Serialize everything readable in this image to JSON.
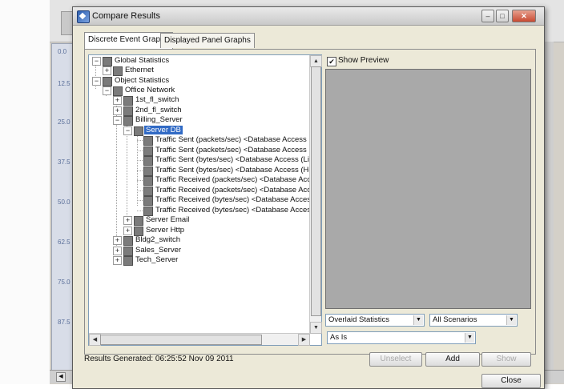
{
  "background": {
    "axis_ticks": [
      "0.0",
      "12.5",
      "25.0",
      "37.5",
      "50.0",
      "62.5",
      "75.0",
      "87.5"
    ]
  },
  "dialog": {
    "title": "Compare Results",
    "titlebar_buttons": {
      "minimize": "–",
      "maximize": "□",
      "close": "✕"
    },
    "tabs": [
      {
        "label": "Discrete Event Graphs",
        "active": true
      },
      {
        "label": "Displayed Panel Graphs",
        "active": false
      }
    ],
    "tree": {
      "items": [
        {
          "label": "Global Statistics",
          "expanded": true
        },
        {
          "label": "Ethernet",
          "expanded": false
        },
        {
          "label": "Object Statistics",
          "expanded": true
        },
        {
          "label": "Office Network",
          "expanded": true
        },
        {
          "label": "1st_fl_switch",
          "expanded": false
        },
        {
          "label": "2nd_fl_switch",
          "expanded": false
        },
        {
          "label": "Billing_Server",
          "expanded": true
        },
        {
          "label": "Server DB",
          "expanded": true,
          "selected": true
        },
        {
          "label": "Traffic Sent (packets/sec) <Database Access (L"
        },
        {
          "label": "Traffic Sent (packets/sec) <Database Access (H"
        },
        {
          "label": "Traffic Sent (bytes/sec) <Database Access (Ligh"
        },
        {
          "label": "Traffic Sent (bytes/sec) <Database Access (Hea"
        },
        {
          "label": "Traffic Received (packets/sec) <Database Acce"
        },
        {
          "label": "Traffic Received (packets/sec) <Database Acce"
        },
        {
          "label": "Traffic Received (bytes/sec) <Database Access"
        },
        {
          "label": "Traffic Received (bytes/sec) <Database Access"
        },
        {
          "label": "Server Email",
          "expanded": false
        },
        {
          "label": "Server Http",
          "expanded": false
        },
        {
          "label": "Bldg2_switch",
          "expanded": false
        },
        {
          "label": "Sales_Server",
          "expanded": false
        },
        {
          "label": "Tech_Server",
          "expanded": false
        }
      ]
    },
    "show_preview": {
      "label": "Show Preview",
      "checked": true
    },
    "stat_mode": {
      "value": "Overlaid Statistics"
    },
    "scenario": {
      "value": "All Scenarios"
    },
    "filter": {
      "value": "As Is"
    },
    "buttons": {
      "unselect": "Unselect",
      "add": "Add",
      "show": "Show",
      "close": "Close"
    },
    "status": "Results Generated: 06:25:52 Nov 09 2011",
    "glyphs": {
      "plus": "+",
      "minus": "−",
      "check": "✔",
      "arrow_down": "▼",
      "arrow_up": "▲",
      "arrow_left": "◀",
      "arrow_right": "▶"
    }
  }
}
